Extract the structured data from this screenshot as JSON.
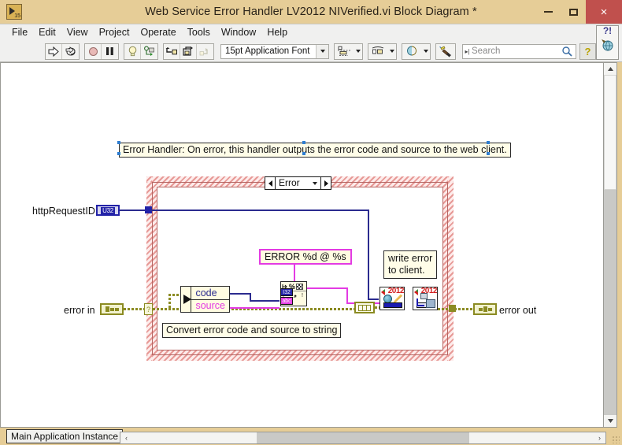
{
  "window": {
    "title": "Web Service Error Handler LV2012 NIVerified.vi Block Diagram *",
    "icon_name": "labview-vi-icon",
    "minimize_label": "",
    "maximize_label": "",
    "close_label": "×"
  },
  "menubar": {
    "items": [
      "File",
      "Edit",
      "View",
      "Project",
      "Operate",
      "Tools",
      "Window",
      "Help"
    ]
  },
  "toolbar": {
    "run_icon": "run-arrow-icon",
    "run_continuous_icon": "run-continuously-icon",
    "abort_icon": "abort-execution-icon",
    "pause_icon": "pause-icon",
    "highlight_icon": "highlight-execution-lightbulb-icon",
    "retain_values_icon": "retain-wire-values-icon",
    "step_into_icon": "step-into-icon",
    "step_over_icon": "step-over-icon",
    "step_out_icon": "step-out-icon",
    "font_selector_value": "15pt Application Font",
    "align_objects_icon": "align-objects-icon",
    "distribute_objects_icon": "distribute-objects-icon",
    "resize_objects_icon": "resize-objects-icon",
    "reorder_icon": "reorder-objects-icon",
    "clean_up_diagram_icon": "clean-up-diagram-icon",
    "search_placeholder": "Search",
    "search_value": "",
    "search_icon": "magnifier-icon",
    "help_icon": "question-mark-help-icon",
    "context_help_icon": "context-help-window-icon",
    "context_help_glyph": "?!"
  },
  "diagram": {
    "top_comment": "Error Handler: On error, this handler outputs the error code and source to the web client.",
    "case_structure": {
      "selector_label": "Error",
      "prev_case_icon": "left-arrow-icon",
      "next_case_icon": "right-arrow-icon",
      "dropdown_icon": "chevron-down-icon"
    },
    "terminals": {
      "http_request_id_label": "httpRequestID",
      "http_request_id_type": "U32",
      "error_in_label": "error in",
      "error_out_label": "error out"
    },
    "unbundle": {
      "node_name": "unbundle-by-name",
      "fields": [
        "code",
        "source"
      ]
    },
    "format_node": {
      "node_name": "format-into-string",
      "percent_glyph": "%",
      "int_type": "I32",
      "string_type": "abc"
    },
    "format_string_constant": "ERROR %d @ %s",
    "comment_convert": "Convert error code and source to string",
    "comment_write": "write error\nto client.",
    "comment_write_line1": "write error",
    "comment_write_line2": "to client.",
    "subvis": [
      {
        "name": "web-write-response-vi",
        "badge": "2012"
      },
      {
        "name": "web-flush-output-vi",
        "badge": "2012"
      }
    ],
    "request_id_constant": "request-id-constant"
  },
  "statusbar": {
    "context": "Main Application Instance",
    "scroll_left_icon": "left-chevron-icon",
    "scroll_right_icon": "right-chevron-icon",
    "resize_grip_icon": "resize-grip-icon"
  },
  "colors": {
    "window_chrome": "#e6cd97",
    "close_button": "#c0504d",
    "case_border": "#e79a97",
    "error_wire": "#8b8b22",
    "string_wire": "#e33be3",
    "numeric_wire": "#2b2b8f",
    "comment_bg": "#fffde8"
  }
}
